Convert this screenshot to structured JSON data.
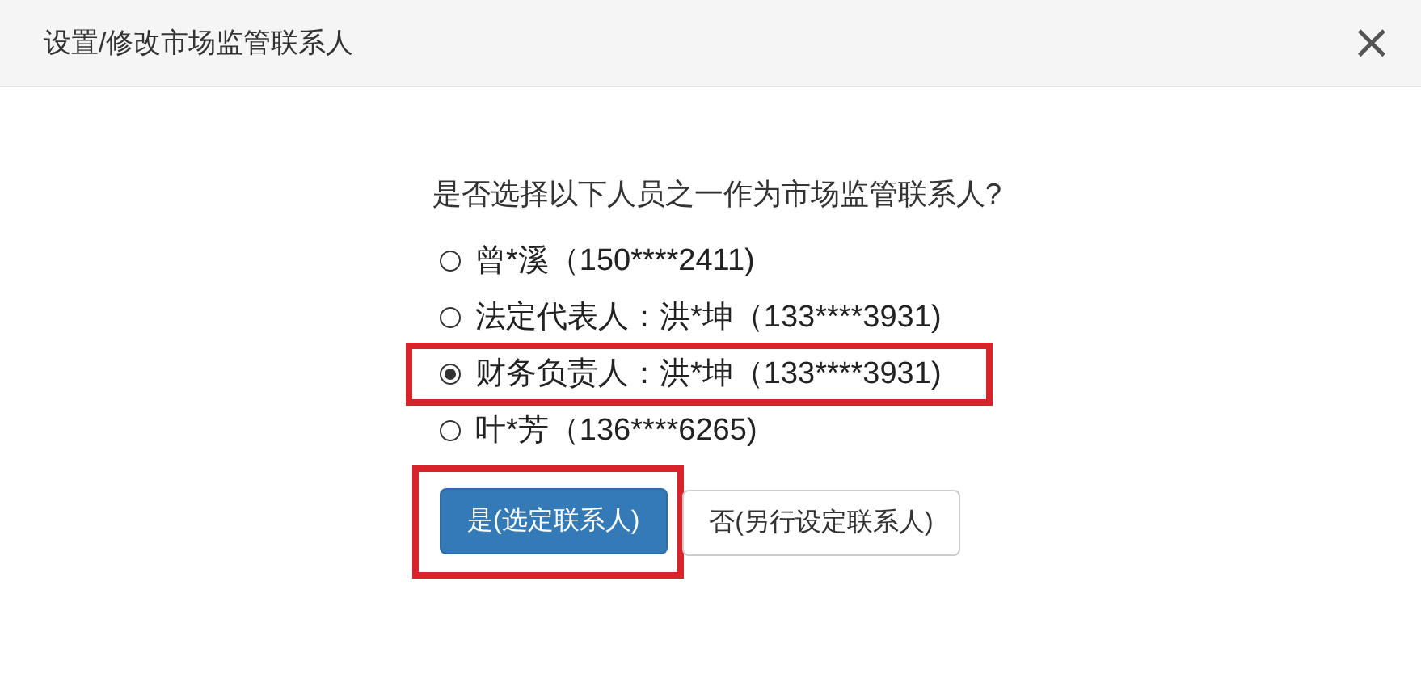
{
  "dialog": {
    "title": "设置/修改市场监管联系人",
    "close": "×"
  },
  "question": "是否选择以下人员之一作为市场监管联系人?",
  "options": [
    {
      "label": "曾*溪（150****2411)",
      "selected": false,
      "highlighted": false
    },
    {
      "label": "法定代表人：洪*坤（133****3931)",
      "selected": false,
      "highlighted": false
    },
    {
      "label": "财务负责人：洪*坤（133****3931)",
      "selected": true,
      "highlighted": true
    },
    {
      "label": "叶*芳（136****6265)",
      "selected": false,
      "highlighted": false
    }
  ],
  "buttons": [
    {
      "label": "是(选定联系人)",
      "kind": "primary",
      "highlighted": true
    },
    {
      "label": "否(另行设定联系人)",
      "kind": "default",
      "highlighted": false
    }
  ]
}
